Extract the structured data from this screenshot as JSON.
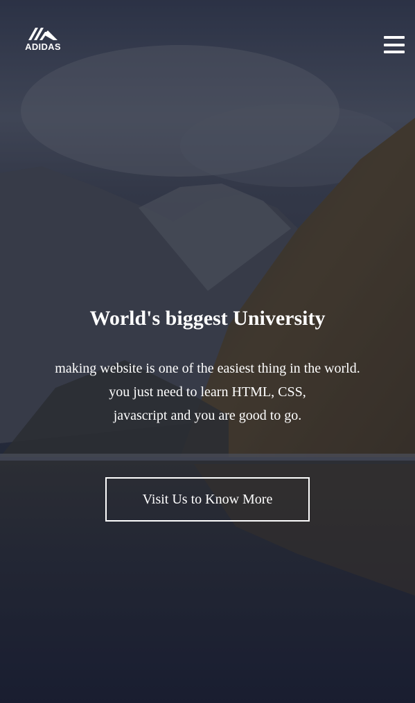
{
  "header": {
    "logo_text": "ADIDAS",
    "logo_icon": "adidas-mountain-logo",
    "menu_icon": "hamburger-menu-icon"
  },
  "hero": {
    "title": "World's biggest University",
    "text_lines": [
      "making website is one of the easiest thing in the world.",
      "you just need to learn HTML, CSS,",
      "javascript and you are good to go."
    ],
    "cta_label": "Visit Us to Know More"
  },
  "colors": {
    "text": "#ffffff",
    "overlay": "#141a32"
  }
}
